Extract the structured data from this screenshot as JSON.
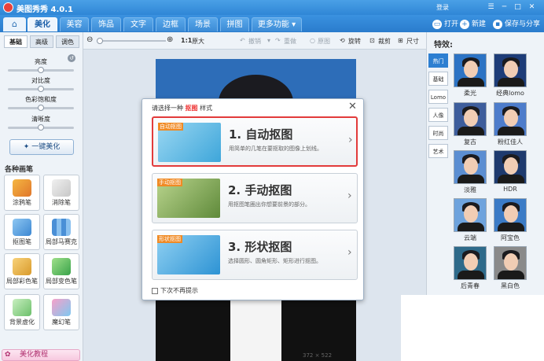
{
  "app": {
    "title": "美图秀秀 4.0.1",
    "login": "登录"
  },
  "window_controls": [
    "☰",
    "─",
    "□",
    "✕"
  ],
  "menu": {
    "home_icon": "house-icon",
    "tabs": [
      "美化",
      "美容",
      "饰品",
      "文字",
      "边框",
      "场景",
      "拼图",
      "更多功能 ▾"
    ],
    "active": "美化"
  },
  "top_actions": {
    "open": "打开",
    "new": "新建",
    "save": "保存与分享"
  },
  "toolbar": {
    "zoom_one": "1:1",
    "original_size": "原大",
    "undo": "撤销",
    "redo": "重做",
    "original_image": "原图",
    "rotate": "旋转",
    "crop": "裁剪",
    "size": "尺寸"
  },
  "left_panel": {
    "subtabs": [
      "基础",
      "高级",
      "调色"
    ],
    "sliders": [
      {
        "label": "亮度",
        "value": 0.5
      },
      {
        "label": "对比度",
        "value": 0.5
      },
      {
        "label": "色彩饱和度",
        "value": 0.5
      },
      {
        "label": "清晰度",
        "value": 0.5
      }
    ],
    "one_click": "一键美化",
    "section": "各种画笔",
    "tools": [
      "涂鸦笔",
      "消除笔",
      "抠图笔",
      "局部马赛克",
      "局部彩色笔",
      "局部变色笔",
      "背景虚化",
      "魔幻笔"
    ],
    "tutorial": "美化教程"
  },
  "dialog": {
    "title_prefix": "请选择一种",
    "title_highlight": "抠图",
    "title_suffix": "样式",
    "options": [
      {
        "tag": "自动抠图",
        "title": "1. 自动抠图",
        "desc": "用简单的几笔在要抠取的图像上划线。",
        "thumb_color": "#7cc6ea"
      },
      {
        "tag": "手动抠图",
        "title": "2. 手动抠图",
        "desc": "用抠图笔圈出你想要前景的部分。",
        "thumb_color": "#8fb36a"
      },
      {
        "tag": "形状抠图",
        "title": "3. 形状抠图",
        "desc": "选择圆形、圆角矩形、矩形进行抠图。",
        "thumb_color": "#5bb4e4"
      }
    ],
    "dont_show": "下次不再提示"
  },
  "status": {
    "dims": "372 × 522"
  },
  "right_panel": {
    "title": "特效:",
    "tabs": [
      "热门",
      "基础",
      "Lomo",
      "人像",
      "时尚",
      "艺术"
    ],
    "active_tab": "热门",
    "effects": [
      {
        "label": "柔光",
        "bg": "#2c73c4"
      },
      {
        "label": "经典lomo",
        "bg": "#1d3c78"
      },
      {
        "label": "复古",
        "bg": "#3d5d9c"
      },
      {
        "label": "粉红佳人",
        "bg": "#4d7ccb"
      },
      {
        "label": "淡雅",
        "bg": "#5b8ed2"
      },
      {
        "label": "HDR",
        "bg": "#1e3a6e"
      },
      {
        "label": "云端",
        "bg": "#6ea3dd"
      },
      {
        "label": "阿宝色",
        "bg": "#3b7bc6"
      },
      {
        "label": "后青春",
        "bg": "#2e6a8a"
      },
      {
        "label": "黑白色",
        "bg": "#8a8a8a"
      }
    ]
  }
}
